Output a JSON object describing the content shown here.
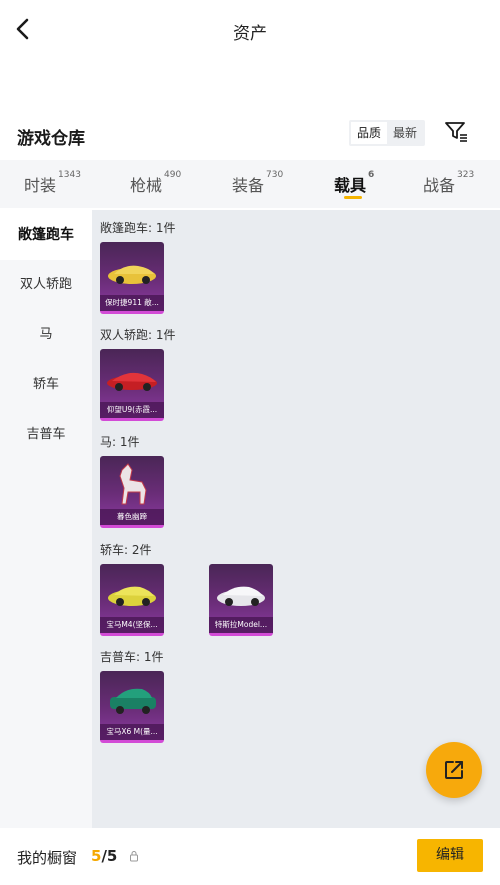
{
  "header": {
    "title": "资产"
  },
  "section": {
    "title": "游戏仓库",
    "sort_options": [
      "品质",
      "最新"
    ]
  },
  "tabs": [
    {
      "label": "时装",
      "count": "1343"
    },
    {
      "label": "枪械",
      "count": "490"
    },
    {
      "label": "装备",
      "count": "730"
    },
    {
      "label": "载具",
      "count": "6"
    },
    {
      "label": "战备",
      "count": "323"
    }
  ],
  "sidebar": [
    "敞篷跑车",
    "双人轿跑",
    "马",
    "轿车",
    "吉普车"
  ],
  "groups": [
    {
      "label": "敞篷跑车: 1件",
      "items": [
        {
          "name": "保时捷911 敞...",
          "color": "#e8c23a"
        }
      ]
    },
    {
      "label": "双人轿跑: 1件",
      "items": [
        {
          "name": "仰望U9(赤霞...",
          "color": "#d8262a"
        }
      ]
    },
    {
      "label": "马: 1件",
      "items": [
        {
          "name": "暮色幽蹄",
          "color": "#e9e2e4"
        }
      ]
    },
    {
      "label": "轿车: 2件",
      "items": [
        {
          "name": "宝马M4(坚保...",
          "color": "#e6dc44"
        },
        {
          "name": "特斯拉Model...",
          "color": "#f1f1f3"
        }
      ]
    },
    {
      "label": "吉普车: 1件",
      "items": [
        {
          "name": "宝马X6 M(量...",
          "color": "#1f8a6a"
        }
      ]
    }
  ],
  "bottom": {
    "label": "我的橱窗",
    "current": "5",
    "total": "/5",
    "edit": "编辑"
  },
  "colors": {
    "accent": "#f7b500",
    "card_rare": "#d24bd6"
  }
}
